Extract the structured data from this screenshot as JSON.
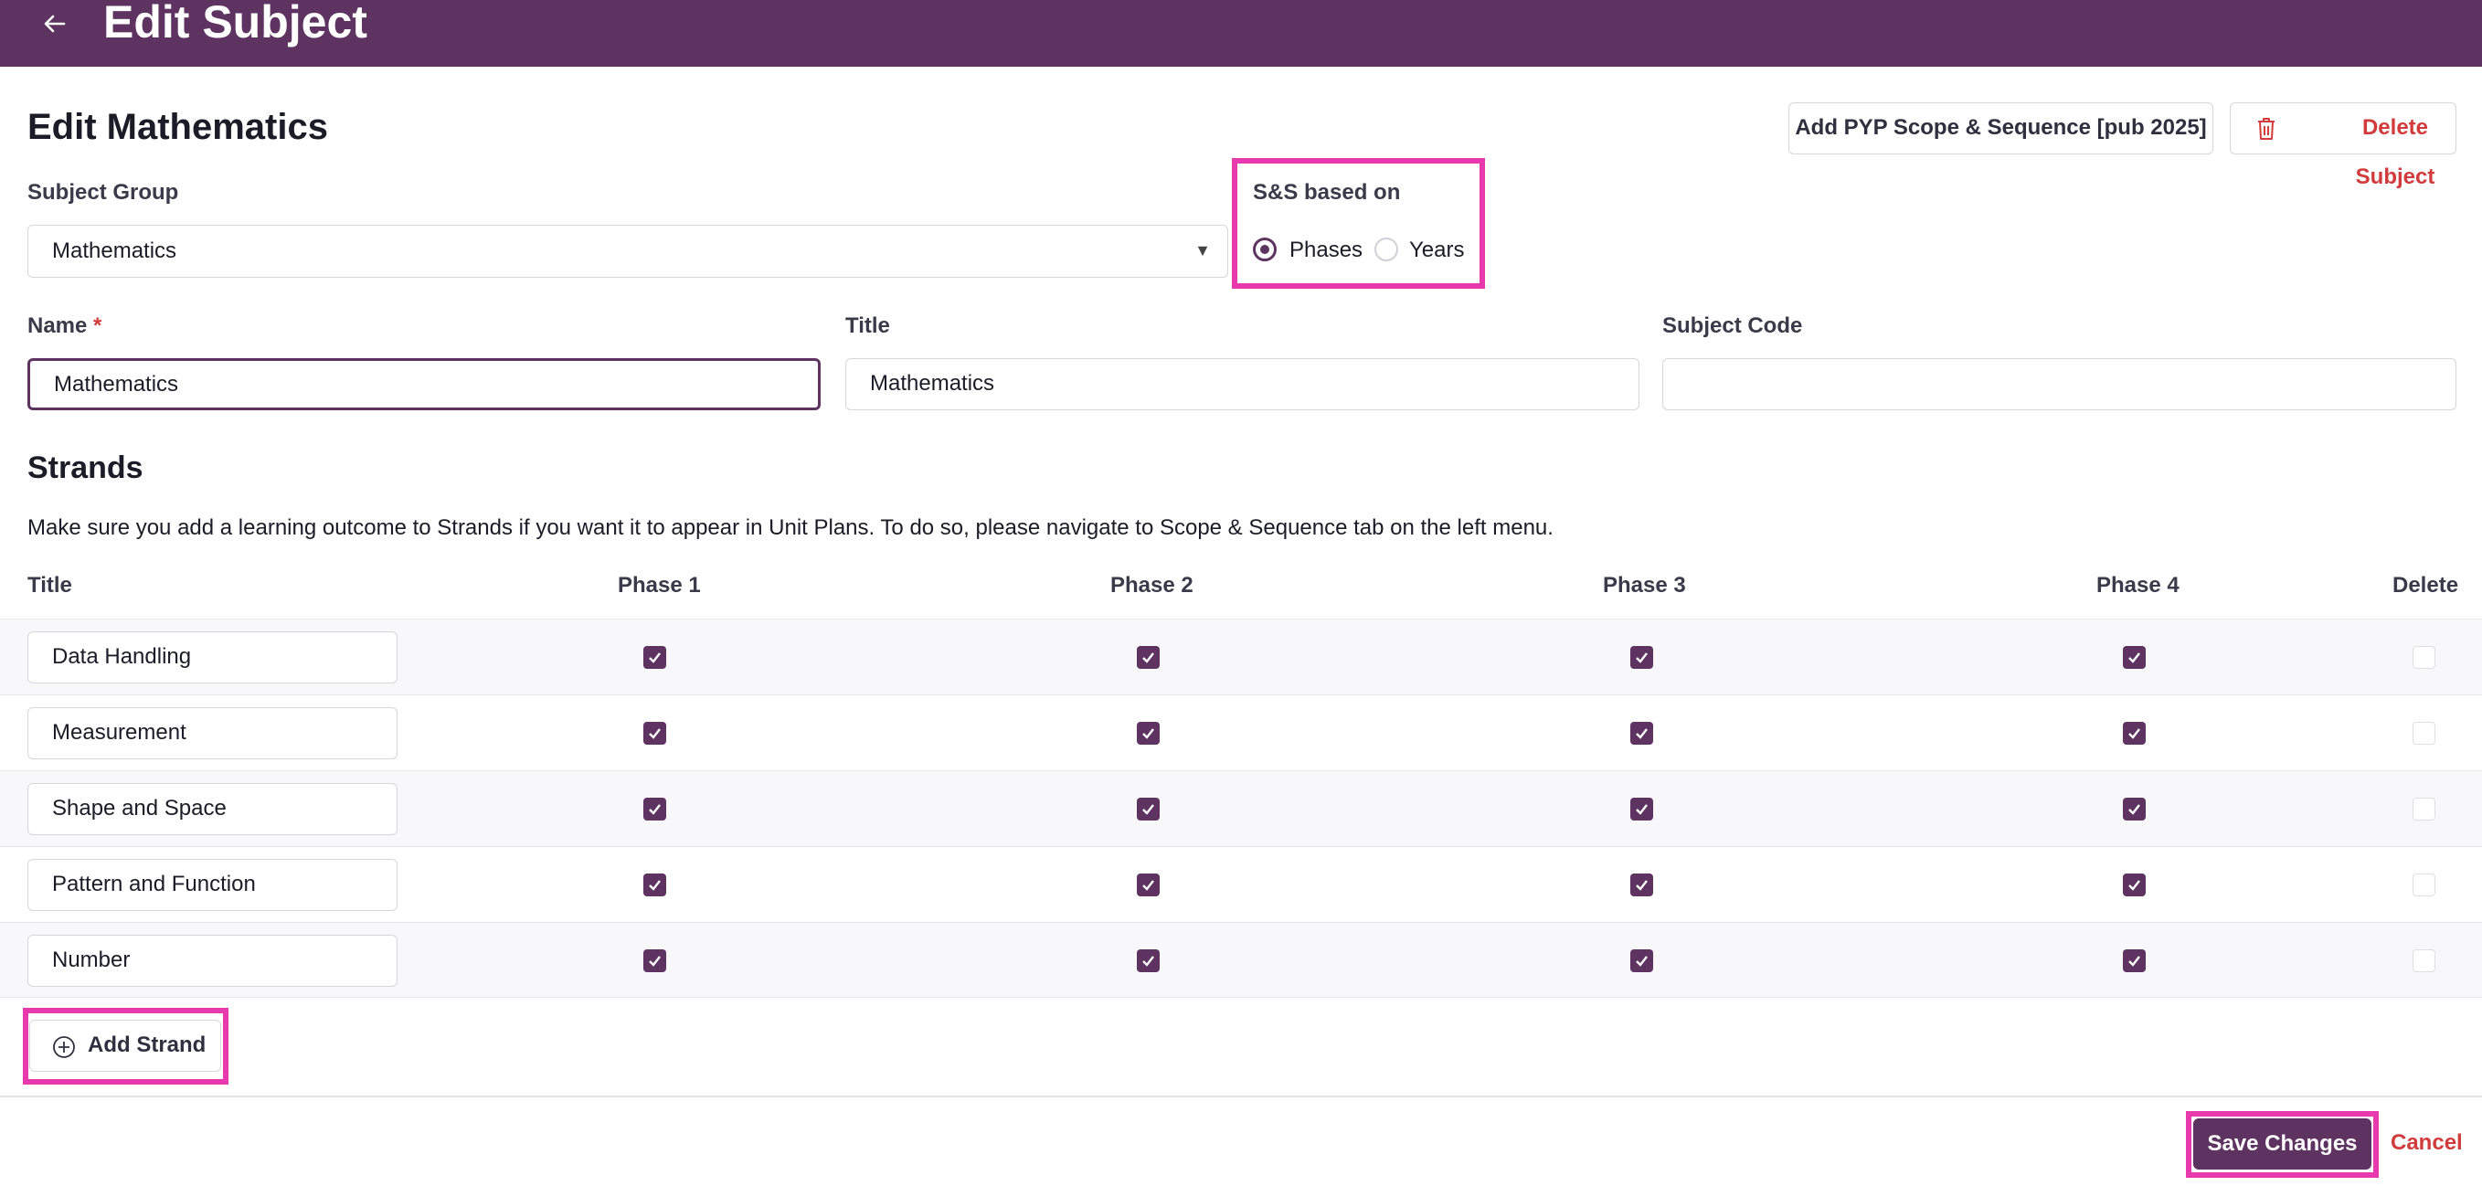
{
  "header": {
    "back_icon": "arrow-left-icon",
    "title": "Edit Subject"
  },
  "page": {
    "heading": "Edit Mathematics"
  },
  "actions": {
    "add_pyp": "Add PYP Scope & Sequence [pub 2025]",
    "delete_subject": "Delete Subject",
    "delete_icon": "trash-icon"
  },
  "form": {
    "subject_group": {
      "label": "Subject Group",
      "value": "Mathematics"
    },
    "ss_based_on": {
      "label": "S&S based on",
      "options": [
        {
          "label": "Phases",
          "selected": true
        },
        {
          "label": "Years",
          "selected": false
        }
      ]
    },
    "name": {
      "label": "Name",
      "required_mark": "*",
      "value": "Mathematics"
    },
    "title": {
      "label": "Title",
      "value": "Mathematics"
    },
    "subject_code": {
      "label": "Subject Code",
      "value": ""
    }
  },
  "strands": {
    "heading": "Strands",
    "help_text": "Make sure you add a learning outcome to Strands if you want it to appear in Unit Plans. To do so, please navigate to Scope & Sequence tab on the left menu.",
    "columns": [
      "Title",
      "Phase 1",
      "Phase 2",
      "Phase 3",
      "Phase 4",
      "Delete"
    ],
    "rows": [
      {
        "title": "Data Handling",
        "phases": [
          true,
          true,
          true,
          true
        ],
        "delete": false
      },
      {
        "title": "Measurement",
        "phases": [
          true,
          true,
          true,
          true
        ],
        "delete": false
      },
      {
        "title": "Shape and Space",
        "phases": [
          true,
          true,
          true,
          true
        ],
        "delete": false
      },
      {
        "title": "Pattern and Function",
        "phases": [
          true,
          true,
          true,
          true
        ],
        "delete": false
      },
      {
        "title": "Number",
        "phases": [
          true,
          true,
          true,
          true
        ],
        "delete": false
      }
    ],
    "add_label": "Add Strand",
    "add_icon": "plus-circle-icon"
  },
  "footer": {
    "save": "Save Changes",
    "cancel": "Cancel"
  },
  "colors": {
    "brand": "#5e3361",
    "highlight": "#e83aad",
    "danger": "#d23b3b"
  }
}
